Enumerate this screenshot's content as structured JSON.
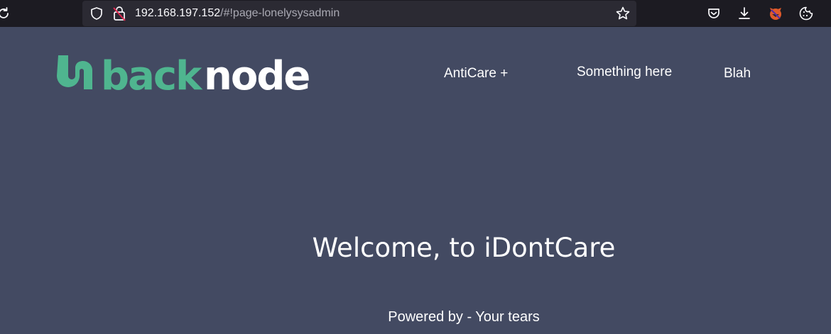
{
  "browser": {
    "url_host": "192.168.197.152",
    "url_rest": "/#!page-lonelysysadmin",
    "icons": [
      "reload-icon",
      "shield-icon",
      "insecure-lock-icon",
      "bookmark-star-icon",
      "pocket-icon",
      "download-icon",
      "extension-fox-icon",
      "cookie-icon"
    ]
  },
  "site": {
    "logo_text_part1": "back",
    "logo_text_part2": "node",
    "nav": {
      "anticare": "AntiCare +",
      "something": "Something here",
      "blah": "Blah"
    },
    "welcome": "Welcome, to iDontCare",
    "powered": "Powered by - Your tears"
  },
  "colors": {
    "background": "#434a62",
    "brand_green": "#4fb58f",
    "toolbar": "#1c1b22"
  }
}
